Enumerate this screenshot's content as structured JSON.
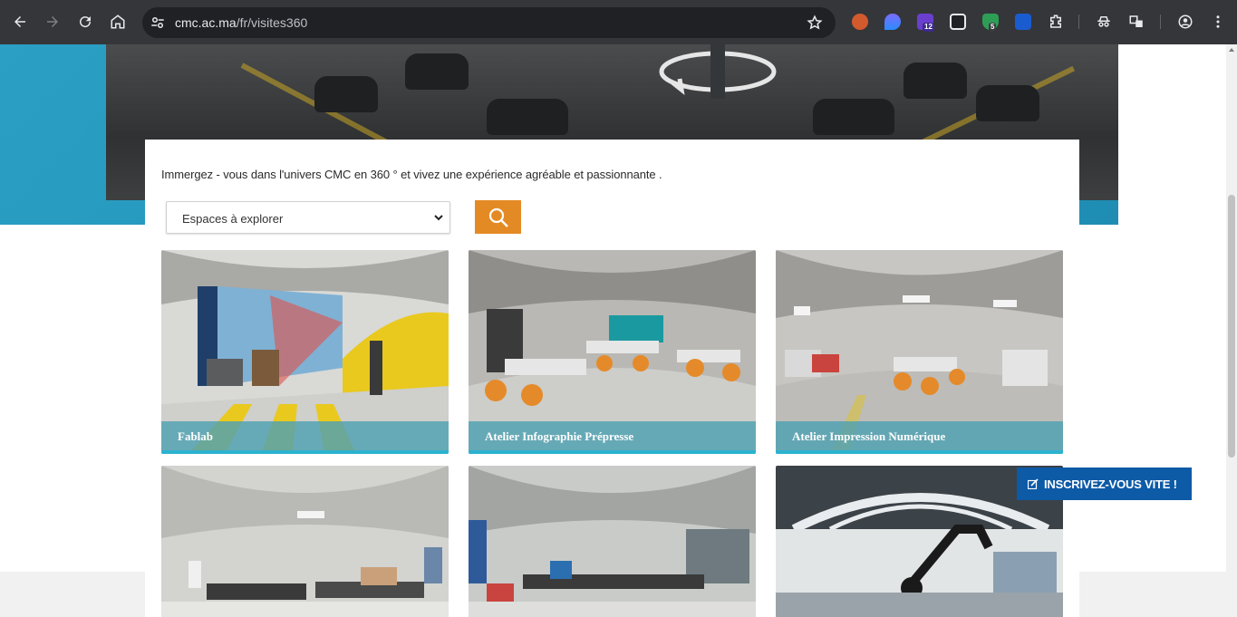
{
  "browser": {
    "url_host": "cmc.ac.ma",
    "url_path": "/fr/visites360",
    "extension_badges": [
      "12",
      "5"
    ]
  },
  "main": {
    "intro": "Immergez - vous dans l'univers CMC en 360 ° et vivez une expérience agréable et passionnante .",
    "select": {
      "selected": "Espaces à explorer"
    },
    "search_icon": "search-icon",
    "tiles": [
      {
        "label": "Fablab"
      },
      {
        "label": "Atelier Infographie Prépresse"
      },
      {
        "label": "Atelier Impression Numérique"
      },
      {
        "label": ""
      },
      {
        "label": ""
      },
      {
        "label": ""
      }
    ]
  },
  "cta": {
    "label": "INSCRIVEZ-VOUS VITE !"
  },
  "colors": {
    "accent_orange": "#e48a24",
    "caption_teal": "#4fa1b2",
    "cta_blue": "#0d5aa7",
    "hero_blue": "#2b9fc4"
  }
}
